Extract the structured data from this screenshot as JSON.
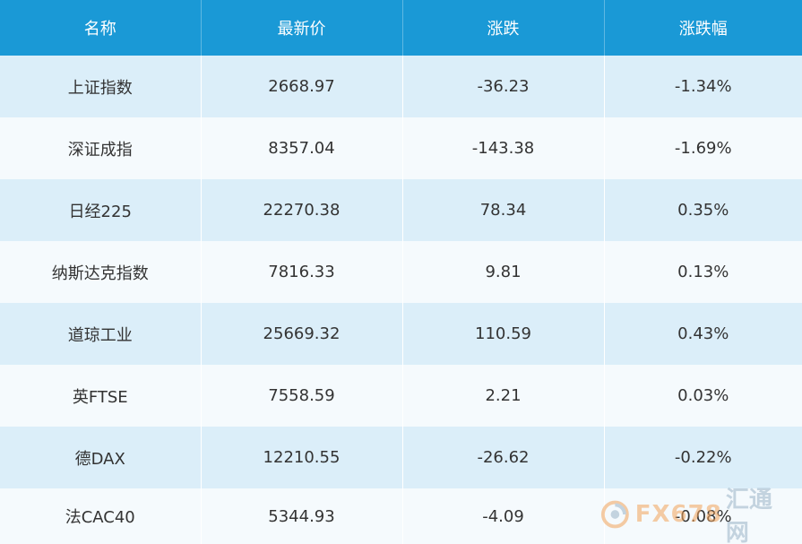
{
  "table": {
    "headers": [
      "名称",
      "最新价",
      "涨跌",
      "涨跌幅"
    ],
    "rows": [
      {
        "name": "上证指数",
        "price": "2668.97",
        "change": "-36.23",
        "pct": "-1.34%"
      },
      {
        "name": "深证成指",
        "price": "8357.04",
        "change": "-143.38",
        "pct": "-1.69%"
      },
      {
        "name": "日经225",
        "price": "22270.38",
        "change": "78.34",
        "pct": "0.35%"
      },
      {
        "name": "纳斯达克指数",
        "price": "7816.33",
        "change": "9.81",
        "pct": "0.13%"
      },
      {
        "name": "道琼工业",
        "price": "25669.32",
        "change": "110.59",
        "pct": "0.43%"
      },
      {
        "name": "英FTSE",
        "price": "7558.59",
        "change": "2.21",
        "pct": "0.03%"
      },
      {
        "name": "德DAX",
        "price": "12210.55",
        "change": "-26.62",
        "pct": "-0.22%"
      },
      {
        "name": "法CAC40",
        "price": "5344.93",
        "change": "-4.09",
        "pct": "-0.08%"
      }
    ]
  },
  "watermark": {
    "latin": "FX678",
    "chinese": "汇通网",
    "icon": "swirl-logo-icon"
  },
  "colors": {
    "header_bg": "#1a99d6",
    "row_odd": "#dbeef9",
    "row_even": "#f5fafd",
    "text": "#333333"
  }
}
